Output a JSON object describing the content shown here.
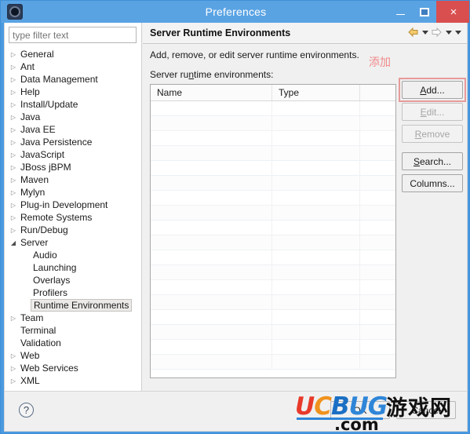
{
  "window": {
    "title": "Preferences",
    "icon": "gear-icon",
    "controls": {
      "minimize": "–",
      "maximize": "□",
      "close": "×"
    }
  },
  "sidebar": {
    "filter": {
      "value": "",
      "placeholder": "type filter text"
    },
    "items": [
      {
        "label": "General",
        "level": 1,
        "expandable": true,
        "expanded": false,
        "selected": false
      },
      {
        "label": "Ant",
        "level": 1,
        "expandable": true,
        "expanded": false,
        "selected": false
      },
      {
        "label": "Data Management",
        "level": 1,
        "expandable": true,
        "expanded": false,
        "selected": false
      },
      {
        "label": "Help",
        "level": 1,
        "expandable": true,
        "expanded": false,
        "selected": false
      },
      {
        "label": "Install/Update",
        "level": 1,
        "expandable": true,
        "expanded": false,
        "selected": false
      },
      {
        "label": "Java",
        "level": 1,
        "expandable": true,
        "expanded": false,
        "selected": false
      },
      {
        "label": "Java EE",
        "level": 1,
        "expandable": true,
        "expanded": false,
        "selected": false
      },
      {
        "label": "Java Persistence",
        "level": 1,
        "expandable": true,
        "expanded": false,
        "selected": false
      },
      {
        "label": "JavaScript",
        "level": 1,
        "expandable": true,
        "expanded": false,
        "selected": false
      },
      {
        "label": "JBoss jBPM",
        "level": 1,
        "expandable": true,
        "expanded": false,
        "selected": false
      },
      {
        "label": "Maven",
        "level": 1,
        "expandable": true,
        "expanded": false,
        "selected": false
      },
      {
        "label": "Mylyn",
        "level": 1,
        "expandable": true,
        "expanded": false,
        "selected": false
      },
      {
        "label": "Plug-in Development",
        "level": 1,
        "expandable": true,
        "expanded": false,
        "selected": false
      },
      {
        "label": "Remote Systems",
        "level": 1,
        "expandable": true,
        "expanded": false,
        "selected": false
      },
      {
        "label": "Run/Debug",
        "level": 1,
        "expandable": true,
        "expanded": false,
        "selected": false
      },
      {
        "label": "Server",
        "level": 1,
        "expandable": true,
        "expanded": true,
        "selected": false
      },
      {
        "label": "Audio",
        "level": 2,
        "expandable": false,
        "expanded": false,
        "selected": false
      },
      {
        "label": "Launching",
        "level": 2,
        "expandable": false,
        "expanded": false,
        "selected": false
      },
      {
        "label": "Overlays",
        "level": 2,
        "expandable": false,
        "expanded": false,
        "selected": false
      },
      {
        "label": "Profilers",
        "level": 2,
        "expandable": false,
        "expanded": false,
        "selected": false
      },
      {
        "label": "Runtime Environments",
        "level": 2,
        "expandable": false,
        "expanded": false,
        "selected": true
      },
      {
        "label": "Team",
        "level": 1,
        "expandable": true,
        "expanded": false,
        "selected": false
      },
      {
        "label": "Terminal",
        "level": 1,
        "expandable": false,
        "expanded": false,
        "selected": false
      },
      {
        "label": "Validation",
        "level": 1,
        "expandable": false,
        "expanded": false,
        "selected": false
      },
      {
        "label": "Web",
        "level": 1,
        "expandable": true,
        "expanded": false,
        "selected": false
      },
      {
        "label": "Web Services",
        "level": 1,
        "expandable": true,
        "expanded": false,
        "selected": false
      },
      {
        "label": "XML",
        "level": 1,
        "expandable": true,
        "expanded": false,
        "selected": false
      }
    ]
  },
  "page": {
    "title": "Server Runtime Environments",
    "description": "Add, remove, or edit server runtime environments.",
    "list_label": "Server runtime environments:",
    "nav": {
      "back": "back-arrow",
      "forward": "forward-arrow",
      "menu": "menu-caret"
    }
  },
  "table": {
    "columns": [
      "Name",
      "Type",
      ""
    ],
    "rows": [],
    "empty_row_count": 18
  },
  "buttons": {
    "add": "Add...",
    "edit": "Edit...",
    "remove": "Remove",
    "search": "Search...",
    "columns": "Columns...",
    "add_highlighted": true,
    "edit_enabled": false,
    "remove_enabled": false
  },
  "annotation": {
    "text": "添加",
    "color": "#f08a8a"
  },
  "footer": {
    "help": "?",
    "ok": "OK",
    "cancel": "Cancel"
  },
  "watermark": {
    "u": "U",
    "c": "C",
    "b": "B",
    "u2": "U",
    "g": "G",
    "chinese": "游戏网",
    "com": ".com"
  },
  "colors": {
    "titlebar": "#5aa3e3",
    "close_button": "#d94f4f",
    "accent_highlight": "#e79a9a",
    "annotation_red": "#f08a8a"
  }
}
